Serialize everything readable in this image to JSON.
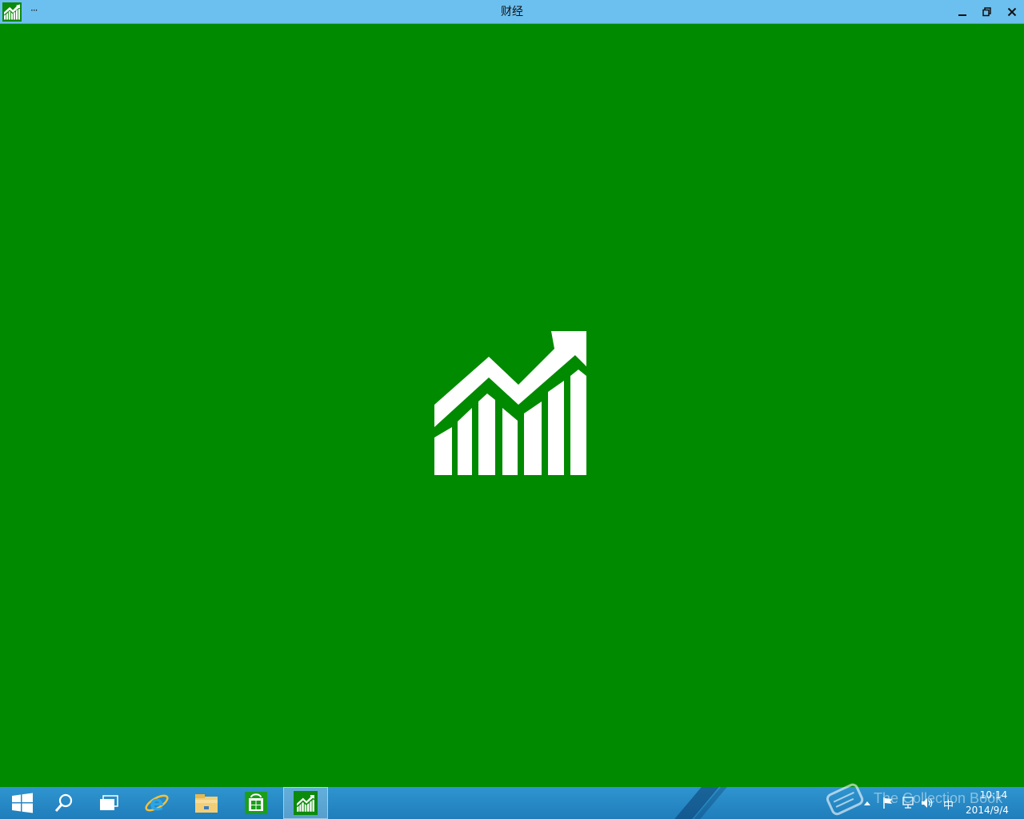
{
  "window": {
    "title": "财经",
    "menu_label": "···",
    "app_icon": "finance-chart-icon",
    "controls": {
      "minimize": "minimize-icon",
      "maximize": "restore-icon",
      "close": "close-icon"
    }
  },
  "splash": {
    "background": "#008a00",
    "logo": "finance-chart-icon",
    "logo_color": "#ffffff"
  },
  "taskbar": {
    "items": [
      {
        "name": "start",
        "icon": "windows-logo-icon"
      },
      {
        "name": "search",
        "icon": "search-icon"
      },
      {
        "name": "task-view",
        "icon": "task-view-icon"
      },
      {
        "name": "internet-explorer",
        "icon": "ie-icon"
      },
      {
        "name": "file-explorer",
        "icon": "folder-icon"
      },
      {
        "name": "store",
        "icon": "store-icon"
      },
      {
        "name": "finance",
        "icon": "finance-chart-icon",
        "active": true
      }
    ],
    "tray": {
      "icons": [
        "show-hidden-icon",
        "flag-icon",
        "network-icon",
        "volume-icon"
      ],
      "ime": "中",
      "time": "10:14",
      "date": "2014/9/4"
    }
  },
  "watermark": {
    "text": "The Collection Book",
    "icon": "book-logo-icon"
  },
  "colors": {
    "titlebar": "#6cc0ef",
    "taskbar": "#2389c6",
    "accent": "#008a00"
  }
}
